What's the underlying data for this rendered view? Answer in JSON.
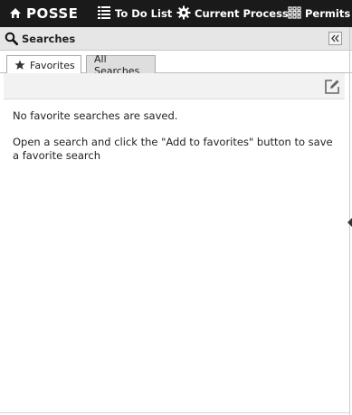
{
  "topbar": {
    "brand": "POSSE",
    "brand_icon": "house-icon",
    "nav": [
      {
        "label": "To Do List",
        "icon": "list-icon"
      },
      {
        "label": "Current Process",
        "icon": "gear-icon"
      },
      {
        "label": "Permits",
        "icon": "grid-icon"
      }
    ]
  },
  "panel": {
    "title": "Searches",
    "title_icon": "search-icon"
  },
  "tabs": [
    {
      "label": "Favorites",
      "icon": "star-icon",
      "selected": true
    },
    {
      "label": "All Searches",
      "selected": false
    }
  ],
  "content": {
    "empty_message": "No favorite searches are saved.",
    "hint": "Open a search and click the \"Add to favorites\" button to save a favorite search"
  },
  "colors": {
    "topbar_bg": "#1a1a1a",
    "panel_header_bg": "#e6e6e6",
    "inactive_tab_bg": "#dedede"
  }
}
